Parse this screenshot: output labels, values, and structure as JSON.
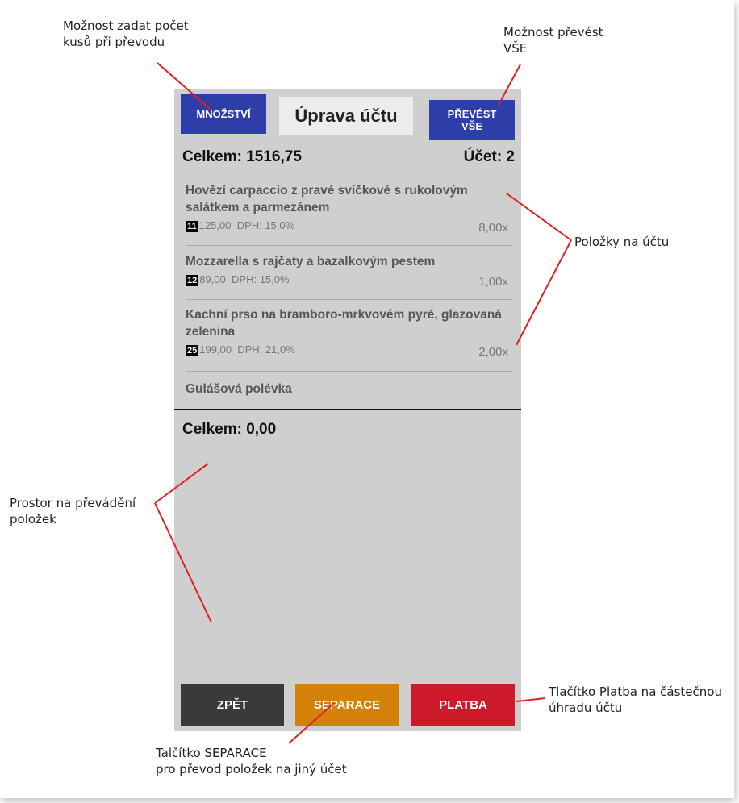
{
  "annotations": {
    "quantity": "Možnost zadat počet\nkusů při převodu",
    "transfer_all": "Možnost převést\nVŠE",
    "items": "Položky na účtu",
    "transfer_space": "Prostor na převádění\npoložek",
    "payment": "Tlačítko Platba na částečnou\núhradu účtu",
    "separation": "Talčítko SEPARACE\npro převod položek na jiný účet"
  },
  "header": {
    "quantity_label": "MNOŽSTVÍ",
    "title": "Úprava účtu",
    "transfer_all_label": "PŘEVÉST\nVŠE"
  },
  "summary": {
    "total": "Celkem: 1516,75",
    "account": "Účet: 2"
  },
  "items": [
    {
      "name": "Hovězí carpaccio z pravé svíčkové s rukolovým salátkem a parmezánem",
      "code": "11",
      "price": "125,00",
      "vat": "DPH: 15,0%",
      "qty": "8,00x"
    },
    {
      "name": "Mozzarella s rajčaty a bazalkovým pestem",
      "code": "12",
      "price": "89,00",
      "vat": "DPH: 15,0%",
      "qty": "1,00x"
    },
    {
      "name": "Kachní prso na bramboro-mrkvovém pyré, glazovaná zelenina",
      "code": "25",
      "price": "199,00",
      "vat": "DPH: 21,0%",
      "qty": "2,00x"
    },
    {
      "name": "Gulášová polévka"
    }
  ],
  "transfer": {
    "total": "Celkem: 0,00"
  },
  "footer": {
    "back_label": "ZPĚT",
    "back_color": "#3a3a3a",
    "separation_label": "SEPARACE",
    "separation_color": "#d4810a",
    "payment_label": "PLATBA",
    "payment_color": "#cc1a2a"
  },
  "colors": {
    "accent_blue": "#2e3ea8",
    "annotation_line": "#e02020",
    "panel_bg": "#cfcfcf"
  }
}
